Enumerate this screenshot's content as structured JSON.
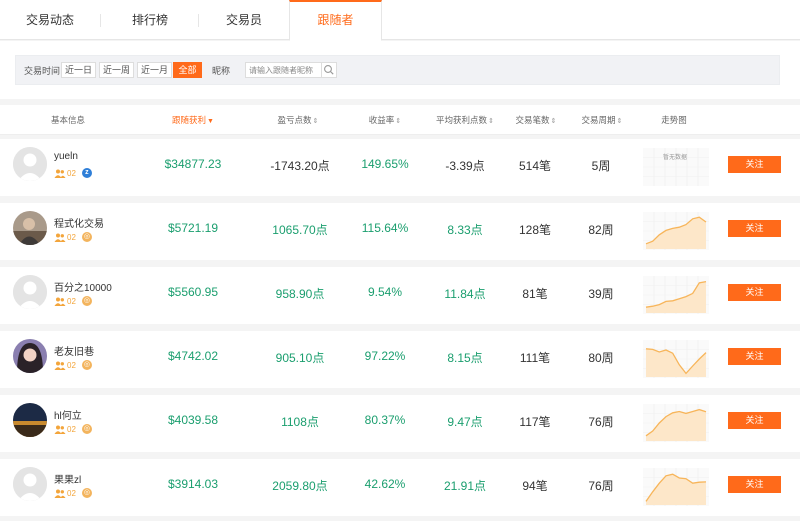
{
  "tabs": [
    {
      "label": "交易动态"
    },
    {
      "label": "排行榜"
    },
    {
      "label": "交易员"
    },
    {
      "label": "跟随者"
    }
  ],
  "filter": {
    "time_label": "交易时间",
    "periods": [
      {
        "label": "近一日"
      },
      {
        "label": "近一周"
      },
      {
        "label": "近一月"
      },
      {
        "label": "全部"
      }
    ],
    "nickname_label": "昵称",
    "search_placeholder": "请输入跟随者昵称"
  },
  "table": {
    "columns": [
      {
        "label": "基本信息"
      },
      {
        "label": "跟随获利"
      },
      {
        "label": "盈亏点数"
      },
      {
        "label": "收益率"
      },
      {
        "label": "平均获利点数"
      },
      {
        "label": "交易笔数"
      },
      {
        "label": "交易周期"
      },
      {
        "label": "走势图"
      }
    ],
    "no_data_text": "暂无数据",
    "follow_label": "关注",
    "rows": [
      {
        "name": "yueln",
        "level": "02",
        "badge_icon": "z-badge-icon",
        "profit": "$34877.23",
        "points": "-1743.20点",
        "rate": "149.65%",
        "avg_points": "-3.39点",
        "trades": "514笔",
        "period": "5周",
        "trend": []
      },
      {
        "name": "程式化交易",
        "level": "02",
        "badge_icon": "gold-badge-icon",
        "profit": "$5721.19",
        "points": "1065.70点",
        "rate": "115.64%",
        "avg_points": "8.33点",
        "trades": "128笔",
        "period": "82周",
        "trend": [
          0.1,
          0.18,
          0.38,
          0.52,
          0.58,
          0.62,
          0.7,
          0.88,
          0.93,
          0.78
        ]
      },
      {
        "name": "百分之10000",
        "level": "02",
        "badge_icon": "gold-badge-icon",
        "profit": "$5560.95",
        "points": "958.90点",
        "rate": "9.54%",
        "avg_points": "11.84点",
        "trades": "81笔",
        "period": "39周",
        "trend": [
          0.12,
          0.15,
          0.2,
          0.3,
          0.32,
          0.38,
          0.45,
          0.55,
          0.88,
          0.92
        ]
      },
      {
        "name": "老友旧巷",
        "level": "02",
        "badge_icon": "gold-badge-icon",
        "profit": "$4742.02",
        "points": "905.10点",
        "rate": "97.22%",
        "avg_points": "8.15点",
        "trades": "111笔",
        "period": "80周",
        "trend": [
          0.82,
          0.8,
          0.72,
          0.78,
          0.68,
          0.32,
          0.05,
          0.28,
          0.5,
          0.7
        ]
      },
      {
        "name": "hl何立",
        "level": "02",
        "badge_icon": "gold-badge-icon",
        "profit": "$4039.58",
        "points": "1108点",
        "rate": "80.37%",
        "avg_points": "9.47点",
        "trades": "117笔",
        "period": "76周",
        "trend": [
          0.1,
          0.25,
          0.5,
          0.7,
          0.82,
          0.86,
          0.8,
          0.86,
          0.92,
          0.85
        ]
      },
      {
        "name": "果果zl",
        "level": "02",
        "badge_icon": "gold-badge-icon",
        "profit": "$3914.03",
        "points": "2059.80点",
        "rate": "42.62%",
        "avg_points": "21.91点",
        "trades": "94笔",
        "period": "76周",
        "trend": [
          0.05,
          0.35,
          0.62,
          0.85,
          0.9,
          0.78,
          0.76,
          0.62,
          0.65,
          0.66
        ]
      }
    ]
  },
  "colors": {
    "accent": "#ff6a1a",
    "positive": "#1a9e6e",
    "level": "#f3a53b",
    "trend_line": "#f7b55a",
    "trend_fill": "#fde7c9"
  }
}
